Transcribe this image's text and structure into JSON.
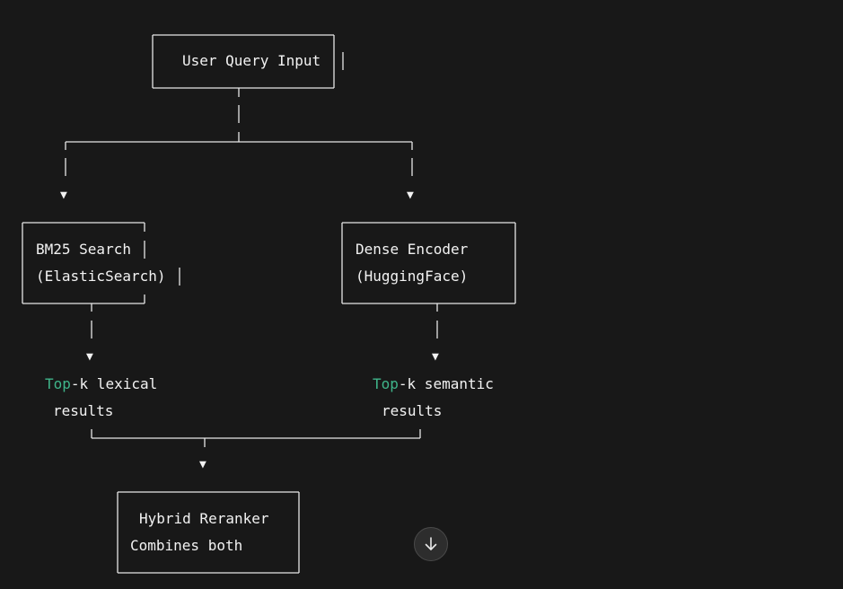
{
  "nodes": {
    "query": {
      "line1": "User Query Input"
    },
    "bm25": {
      "line1": "BM25 Search",
      "line2": "(ElasticSearch)"
    },
    "dense": {
      "line1": "Dense Encoder",
      "line2": "(HuggingFace)"
    },
    "lexical": {
      "keyword": "Top",
      "rest": "-k lexical",
      "line2": "results"
    },
    "semantic": {
      "keyword": "Top",
      "rest": "-k semantic",
      "line2": "results"
    },
    "reranker": {
      "line1": "Hybrid Reranker",
      "line2": "Combines both"
    }
  },
  "arrow_glyph": "▼",
  "colors": {
    "background": "#181818",
    "text": "#f2f2f2",
    "keyword": "#3fb58a"
  },
  "scroll_button": {
    "icon": "arrow-down-icon"
  }
}
